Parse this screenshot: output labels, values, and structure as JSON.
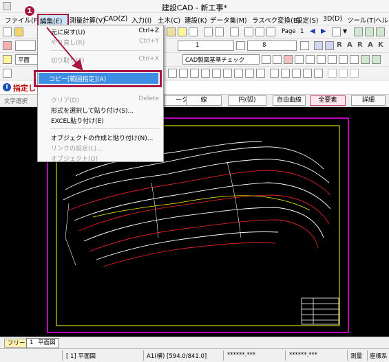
{
  "window": {
    "title": "建設CAD - 新工事*"
  },
  "menubar": {
    "items": [
      "ファイル(F)",
      "編集(E)",
      "測量計算(V)",
      "CAD(Z)",
      "入力(I)",
      "土木(C)",
      "建設(K)",
      "データ集(M)",
      "ラスペク変換(B)",
      "設定(S)",
      "3D(D)",
      "ツール(T)",
      "ヘルプ"
    ]
  },
  "toolbar1": {
    "page_label": "Page",
    "page_number": "1"
  },
  "toolbar2": {
    "layer_value": "1",
    "color_value": "8"
  },
  "toolbar3": {
    "layer_name": "平面",
    "check_value": "CAD製図基準チェック"
  },
  "row4": {
    "prompt": "指定し"
  },
  "row5": {
    "label": "文字選択",
    "buttons": [
      "ーク",
      "線",
      "円(弧)",
      "自由曲線",
      "全要素",
      "詳細"
    ]
  },
  "edit_menu": {
    "items": [
      {
        "label": "元に戻す(U)",
        "shortcut": "Ctrl+Z",
        "disabled": false
      },
      {
        "label": "やり直し(R)",
        "shortcut": "Ctrl+Y",
        "disabled": true
      },
      {
        "label": "切り取り(T)",
        "shortcut": "Ctrl+X",
        "disabled": true
      },
      {
        "label": "コピー[範囲指定](A)",
        "shortcut": "",
        "disabled": false
      },
      {
        "label": "クリア(D)",
        "shortcut": "Delete",
        "disabled": true
      },
      {
        "label": "形式を選択して貼り付け(S)...",
        "shortcut": "",
        "disabled": false
      },
      {
        "label": "EXCEL貼り付け(E)",
        "shortcut": "",
        "disabled": false
      },
      {
        "label": "オブジェクトの作成と貼り付け(N)...",
        "shortcut": "",
        "disabled": false
      },
      {
        "label": "リンクの設定(L)...",
        "shortcut": "",
        "disabled": true
      },
      {
        "label": "オブジェクト(O)",
        "shortcut": "",
        "disabled": true
      }
    ]
  },
  "callout": {
    "number": "1"
  },
  "bottom_tabs": {
    "free": "フリー",
    "page_num": "1",
    "page_name": "平面図"
  },
  "status": {
    "layer": "[ 1] 平面図",
    "paper": "A1(横) [594.0/841.0]",
    "coord1": "******.***",
    "coord2": "******.***",
    "mode": "測量",
    "coordsys": "座標系"
  },
  "colors": {
    "accent": "#a8163f",
    "highlight": "#3d8ee3",
    "canvas": "#000000",
    "frame": "#ff00ff",
    "inner_frame": "#ffff00"
  }
}
